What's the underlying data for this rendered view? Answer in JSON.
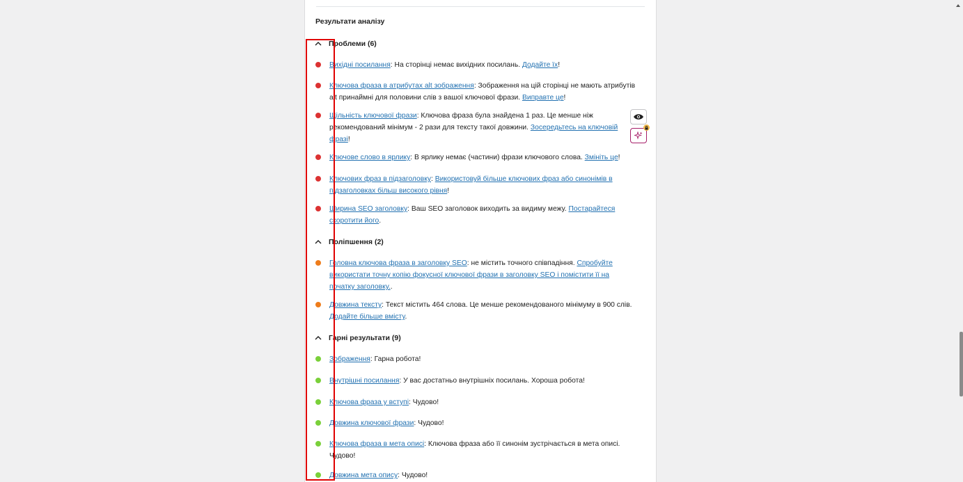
{
  "colors": {
    "problem": "#dc3232",
    "improvement": "#ee7c1b",
    "good": "#7ad03a",
    "link": "#2271b1",
    "highlight": "#e00000"
  },
  "title": "Результати аналізу",
  "groups": [
    {
      "label": "Проблеми (6)",
      "icon": "chevron-up-icon"
    },
    {
      "label": "Поліпшення (2)",
      "icon": "chevron-up-icon"
    },
    {
      "label": "Гарні результати (9)",
      "icon": "chevron-up-icon"
    }
  ],
  "problems": [
    {
      "status": "red",
      "link": "Вихідні посилання",
      "text": ": На сторінці немає вихідних посилань. ",
      "action": "Додайте їх",
      "tail": "!"
    },
    {
      "status": "red",
      "link": "Ключова фраза в атрибутах alt зображення",
      "text": ": Зображення на цій сторінці не мають атрибутів alt принаймні для половини слів з вашої ключової фрази. ",
      "action": "Виправте це",
      "tail": "!"
    },
    {
      "status": "red",
      "link": "Щільність ключової фрази",
      "text": ": Ключова фраза була знайдена 1 раз. Це менше ніж рекомендований мінімум - 2 рази для тексту такої довжини. ",
      "action": "Зосередьтесь на ключовій фразі",
      "tail": "!"
    },
    {
      "status": "red",
      "link": "Ключове слово в ярлику",
      "text": ": В ярлику немає (частини) фрази ключового слова. ",
      "action": "Змініть це",
      "tail": "!"
    },
    {
      "status": "red",
      "link": "Ключових фраз в підзаголовку",
      "text": ": ",
      "action": "Використовуй більше ключових фраз або синонімів в підзаголовках більш високого рівня",
      "tail": "!"
    },
    {
      "status": "red",
      "link": "Ширина SEO заголовку",
      "text": ": Ваш SEO заголовок виходить за видиму межу. ",
      "action": "Постарайтеся скоротити його",
      "tail": "."
    }
  ],
  "improvements": [
    {
      "status": "orange",
      "link": "Головна ключова фраза в заголовку SEO",
      "text": ": не містить точного співпадіння. ",
      "action": "Спробуйте використати точну копію фокусної ключової фрази в заголовку SEO і помістити її на початку заголовку.",
      "tail": "."
    },
    {
      "status": "orange",
      "link": "Довжина тексту",
      "text": ": Текст містить 464 слова. Це менше рекомендованого мінімуму в 900 слів. ",
      "action": "Додайте більше вмісту",
      "tail": "."
    }
  ],
  "good": [
    {
      "status": "green",
      "link": "Зображення",
      "text": ": Гарна робота!",
      "action": "",
      "tail": ""
    },
    {
      "status": "green",
      "link": "Внутрішні посилання",
      "text": ": У вас достатньо внутрішніх посилань. Хороша робота!",
      "action": "",
      "tail": ""
    },
    {
      "status": "green",
      "link": "Ключова фраза у вступі",
      "text": ": Чудово!",
      "action": "",
      "tail": ""
    },
    {
      "status": "green",
      "link": "Довжина ключової фрази",
      "text": ": Чудово!",
      "action": "",
      "tail": ""
    },
    {
      "status": "green",
      "link": "Ключова фраза в мета описі",
      "text": ": Ключова фраза або її синонім зустрічається в мета описі. Чудово!",
      "action": "",
      "tail": ""
    },
    {
      "status": "green",
      "link": "Довжина мета опису",
      "text": ": Чудово!",
      "action": "",
      "tail": ""
    }
  ]
}
